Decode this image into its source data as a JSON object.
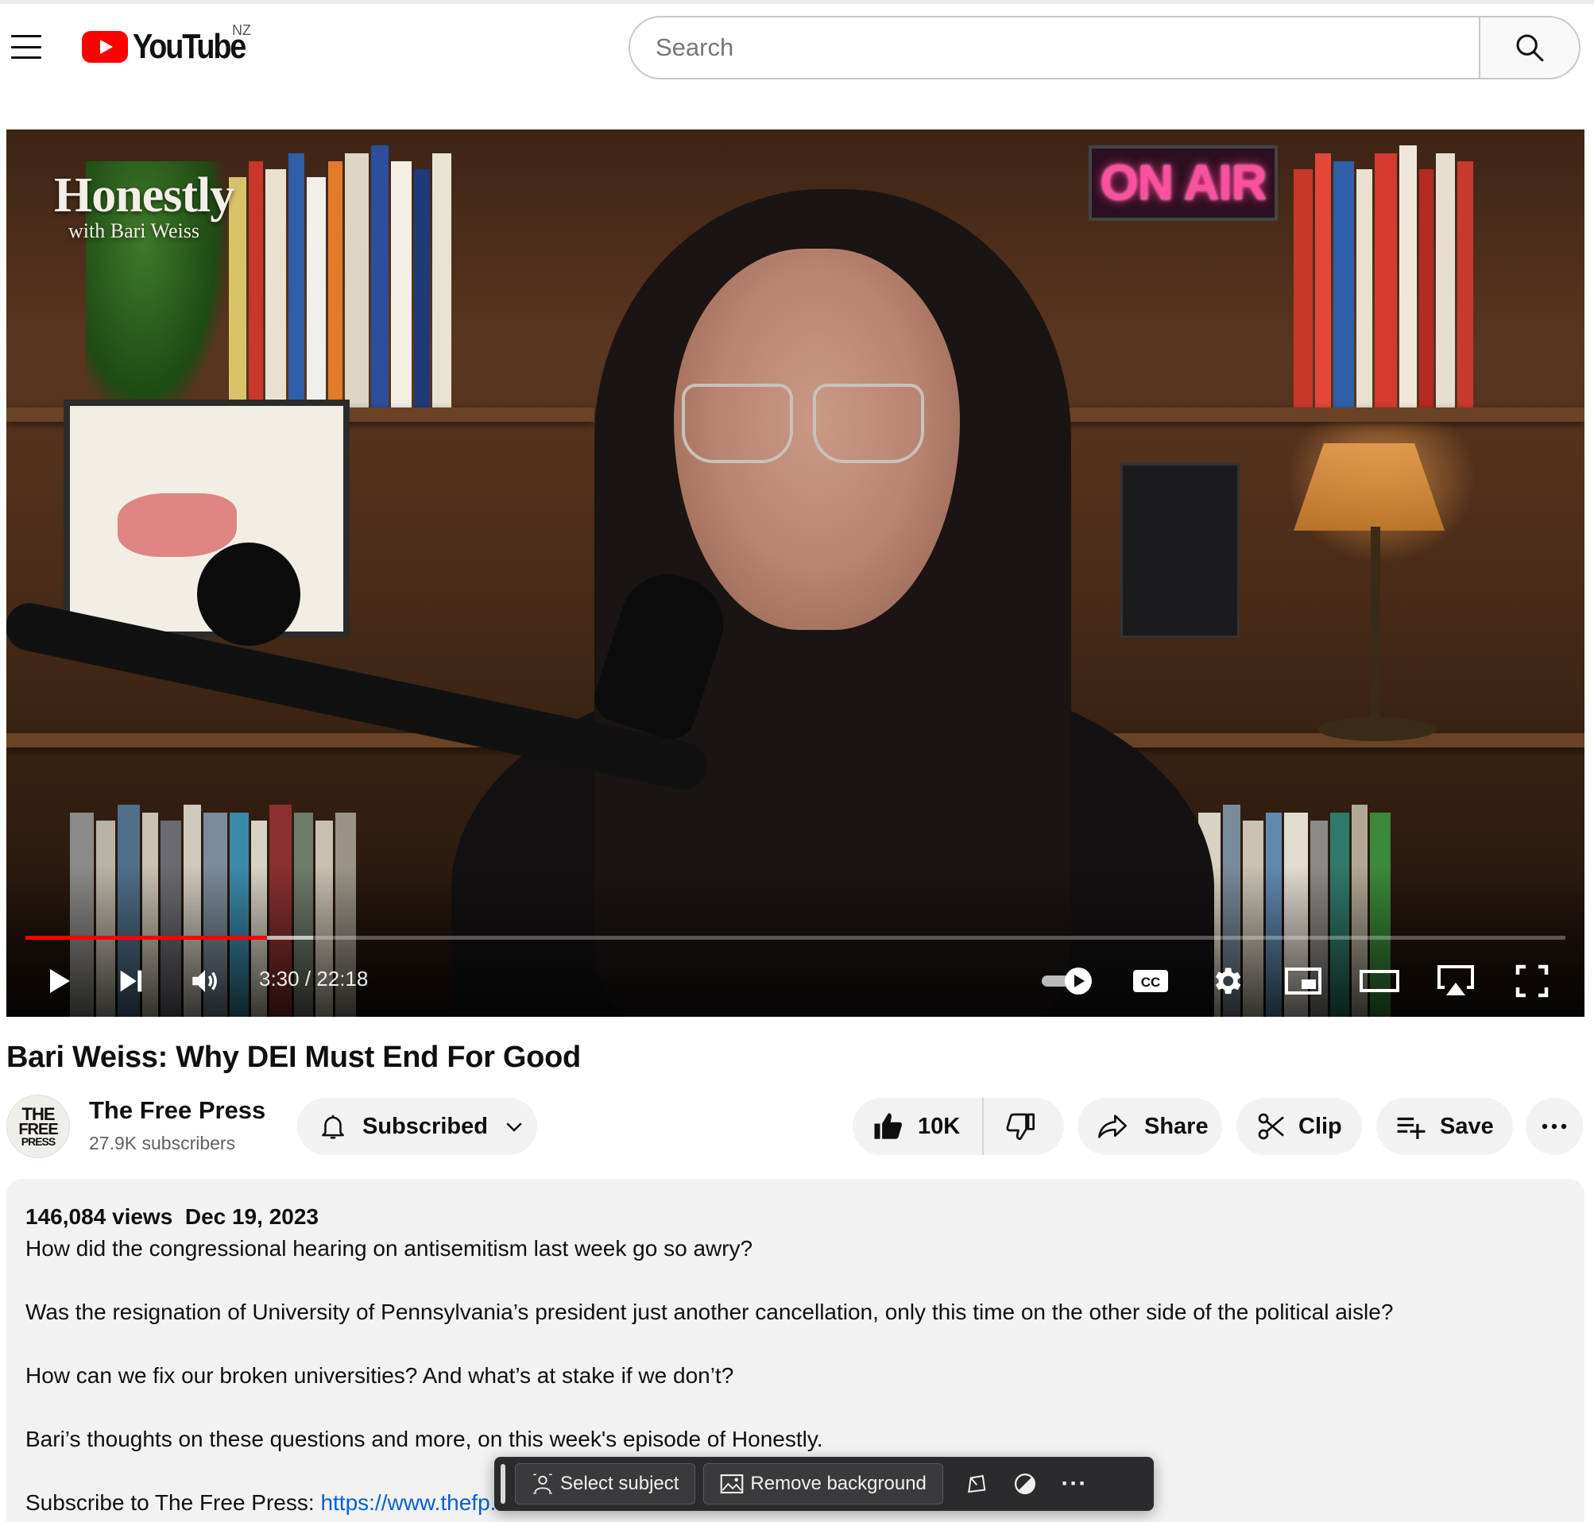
{
  "header": {
    "logo_text": "YouTube",
    "region": "NZ",
    "search_placeholder": "Search"
  },
  "video": {
    "overlay_title": "Honestly",
    "overlay_subtitle": "with Bari Weiss",
    "sign_text": "ON AIR",
    "current_time": "3:30",
    "duration": "22:18",
    "time_display": "3:30 / 22:18",
    "progress_fraction": 0.157,
    "buffered_fraction": 0.187,
    "autoplay_on": true,
    "cc_label": "CC"
  },
  "title": "Bari Weiss: Why DEI Must End For Good",
  "channel": {
    "avatar_lines": [
      "THE",
      "FREE",
      "PRESS"
    ],
    "name": "The Free Press",
    "subscribers": "27.9K subscribers",
    "subscribe_label": "Subscribed"
  },
  "actions": {
    "likes": "10K",
    "share": "Share",
    "clip": "Clip",
    "save": "Save"
  },
  "description": {
    "views": "146,084 views",
    "date": "Dec 19, 2023",
    "paragraphs": [
      "How did the congressional hearing on antisemitism last week go so awry?",
      "Was the resignation of University of Pennsylvania’s president just another cancellation, only this time on the other side of the political aisle?",
      "How can we fix our broken universities? And what’s at stake if we don’t?",
      "Bari’s thoughts on these questions and more, on this week's episode of Honestly."
    ],
    "subscribe_prefix": "Subscribe to The Free Press: ",
    "subscribe_link": "https://www.thefp."
  },
  "mac_toolbar": {
    "select_subject": "Select subject",
    "remove_background": "Remove background",
    "more": "···"
  },
  "colors": {
    "brand_red": "#ff0000",
    "link_blue": "#065fd4",
    "pill_bg": "#f2f2f2"
  }
}
